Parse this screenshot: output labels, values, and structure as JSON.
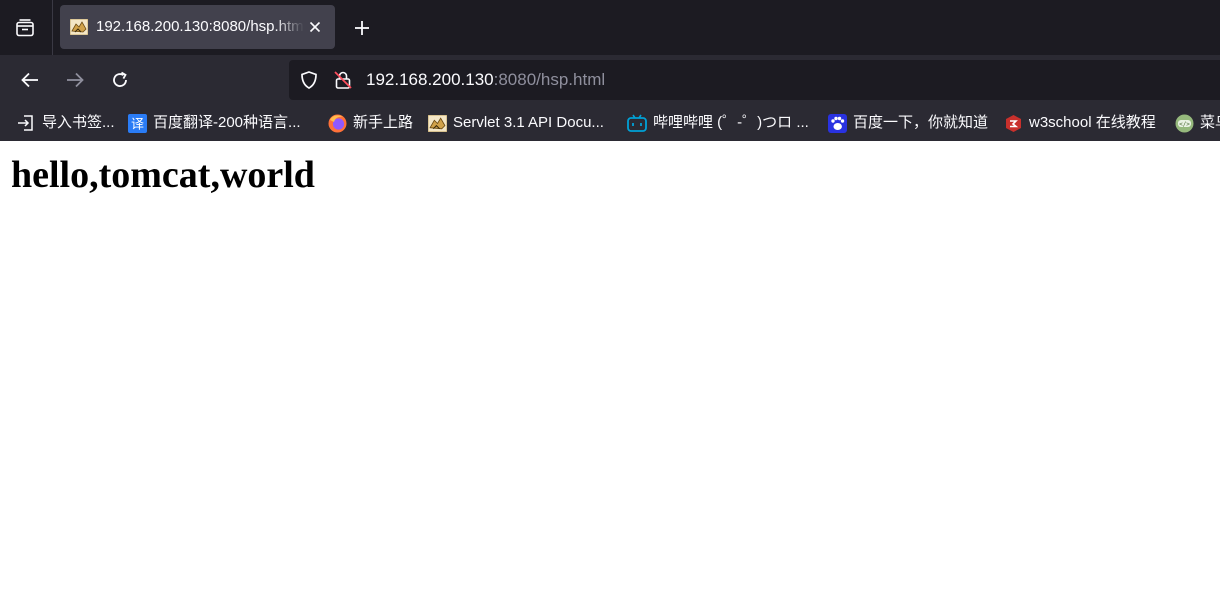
{
  "colors": {
    "tabbar_bg": "#1c1b22",
    "active_tab_bg": "#42414d",
    "toolbar_bg": "#2b2a33",
    "urlbar_bg": "#1c1b22",
    "text_primary": "#fbfbfe",
    "text_dim": "#8f8f9d",
    "page_bg": "#ffffff"
  },
  "tabs": [
    {
      "title": "192.168.200.130:8080/hsp.html",
      "favicon": "tomcat-favicon",
      "active": true
    }
  ],
  "nav": {
    "back_icon": "back-arrow-icon",
    "forward_icon": "forward-arrow-icon",
    "reload_icon": "reload-icon"
  },
  "urlbar": {
    "host": "192.168.200.130",
    "rest": ":8080/hsp.html",
    "shield_icon": "tracking-protection-shield-icon",
    "lock_icon": "insecure-lock-icon"
  },
  "bookmarks": [
    {
      "label": "导入书签...",
      "icon": "import-icon"
    },
    {
      "label": "百度翻译-200种语言...",
      "icon": "baidu-translate-icon"
    },
    {
      "label": "新手上路",
      "icon": "firefox-icon"
    },
    {
      "label": "Servlet 3.1 API Docu...",
      "icon": "tomcat-favicon"
    },
    {
      "label": "哔哩哔哩 (゜-゜)つロ ...",
      "icon": "bilibili-icon"
    },
    {
      "label": "百度一下，你就知道",
      "icon": "baidu-paw-icon"
    },
    {
      "label": "w3school 在线教程",
      "icon": "w3school-icon"
    },
    {
      "label": "菜鸟",
      "icon": "runoob-icon"
    }
  ],
  "page": {
    "heading": "hello,tomcat,world"
  }
}
